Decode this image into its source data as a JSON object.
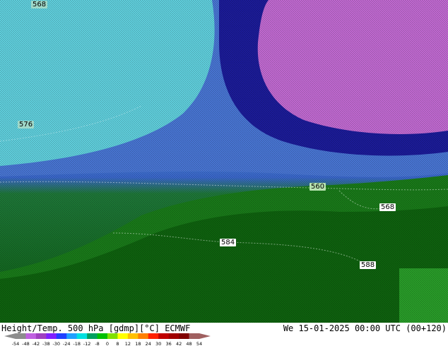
{
  "footer": {
    "left_title": "Height/Temp. 500 hPa [gdmp][°C] ECMWF",
    "right_time": "We 15-01-2025 00:00 UTC (00+120)"
  },
  "contour_labels": [
    {
      "text": "568",
      "bg": "#9fd8c8"
    },
    {
      "text": "576",
      "bg": "#9fd8c8"
    },
    {
      "text": "560",
      "bg": "#b7e3b0"
    },
    {
      "text": "568",
      "bg": "#ffffff"
    },
    {
      "text": "584",
      "bg": "#ffffff"
    },
    {
      "text": "588",
      "bg": "#ffffff"
    }
  ],
  "color_scale": {
    "ticks": [
      "-54",
      "-48",
      "-42",
      "-38",
      "-30",
      "-24",
      "-18",
      "-12",
      "-8",
      "0",
      "8",
      "12",
      "18",
      "24",
      "30",
      "36",
      "42",
      "48",
      "54"
    ],
    "colors": [
      "#8c8c8c",
      "#c060e0",
      "#a040c0",
      "#8020ff",
      "#2040ff",
      "#20a0ff",
      "#00e0e0",
      "#00a060",
      "#00c000",
      "#80e000",
      "#ffff00",
      "#ffc000",
      "#ff8000",
      "#ff2000",
      "#c00000",
      "#a00000",
      "#800000",
      "#a06060"
    ]
  },
  "colors": {
    "cold_core": "#c86fd8",
    "deep_blue": "#1a1aa0",
    "mid_blue": "#4a7ad8",
    "cyan": "#5ad0e0",
    "green_dark": "#0a5a0a",
    "green_mid": "#1e8a1e"
  }
}
